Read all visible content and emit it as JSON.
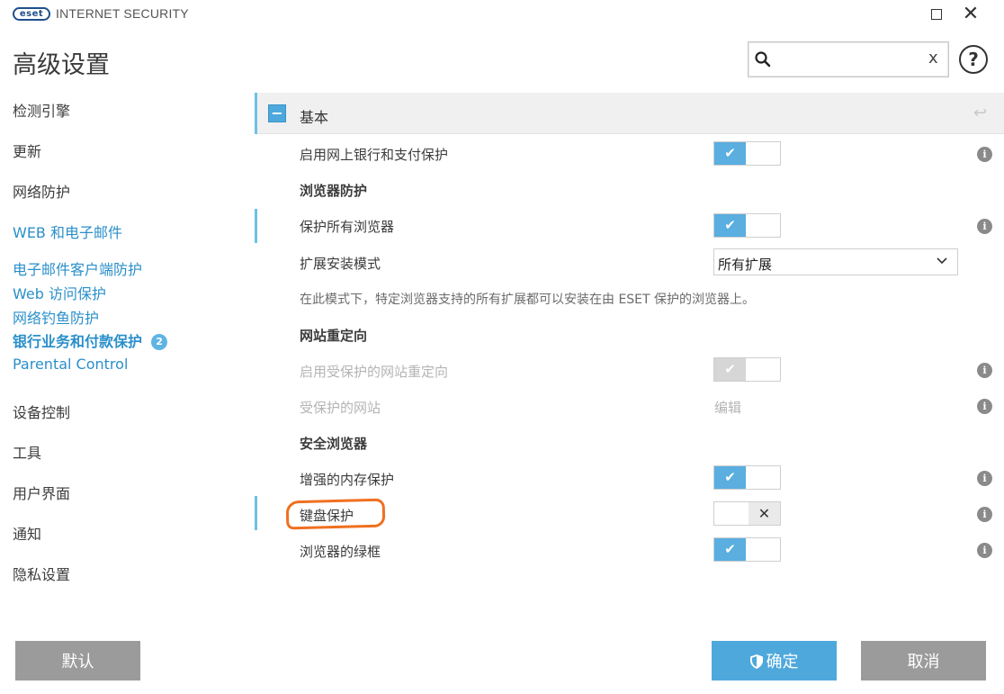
{
  "window": {
    "logo_text": "eset",
    "product_name": "INTERNET SECURITY",
    "maximize_icon": "maximize-icon",
    "close_glyph": "✕"
  },
  "header": {
    "title": "高级设置",
    "search_value": "",
    "search_clear": "x",
    "help_glyph": "?"
  },
  "sidebar": {
    "items": [
      {
        "label": "检测引擎"
      },
      {
        "label": "更新"
      },
      {
        "label": "网络防护"
      },
      {
        "label": "WEB 和电子邮件"
      },
      {
        "label": "电子邮件客户端防护"
      },
      {
        "label": "Web 访问保护"
      },
      {
        "label": "网络钓鱼防护"
      },
      {
        "label": "银行业务和付款保护",
        "badge": "2"
      },
      {
        "label": "Parental Control"
      },
      {
        "label": "设备控制"
      },
      {
        "label": "工具"
      },
      {
        "label": "用户界面"
      },
      {
        "label": "通知"
      },
      {
        "label": "隐私设置"
      }
    ]
  },
  "section": {
    "collapse_glyph": "−",
    "title": "基本",
    "revert_glyph": "↩"
  },
  "rows": {
    "banking": {
      "label": "启用网上银行和支付保护",
      "enabled": true
    },
    "browser_protection_heading": "浏览器防护",
    "protect_all": {
      "label": "保护所有浏览器",
      "enabled": true
    },
    "extension_mode": {
      "label": "扩展安装模式",
      "value": "所有扩展"
    },
    "extension_desc": "在此模式下，特定浏览器支持的所有扩展都可以安装在由 ESET 保护的浏览器上。",
    "redirect_heading": "网站重定向",
    "redirect": {
      "label": "启用受保护的网站重定向",
      "enabled": true,
      "disabled": true
    },
    "protected_sites": {
      "label": "受保护的网站",
      "action": "编辑"
    },
    "secure_browser_heading": "安全浏览器",
    "memory_protection": {
      "label": "增强的内存保护",
      "enabled": true
    },
    "keyboard_protection": {
      "label": "键盘保护",
      "enabled": false
    },
    "green_frame": {
      "label": "浏览器的绿框",
      "enabled": true
    }
  },
  "toggle_glyphs": {
    "on": "✔",
    "off": "✕"
  },
  "info_glyph": "i",
  "footer": {
    "default_label": "默认",
    "ok_label": "确定",
    "cancel_label": "取消"
  },
  "colors": {
    "accent": "#4ea8dc",
    "sidebar_link": "#2b8fca",
    "highlight": "#f0701f",
    "button_gray": "#9b9b9b"
  }
}
